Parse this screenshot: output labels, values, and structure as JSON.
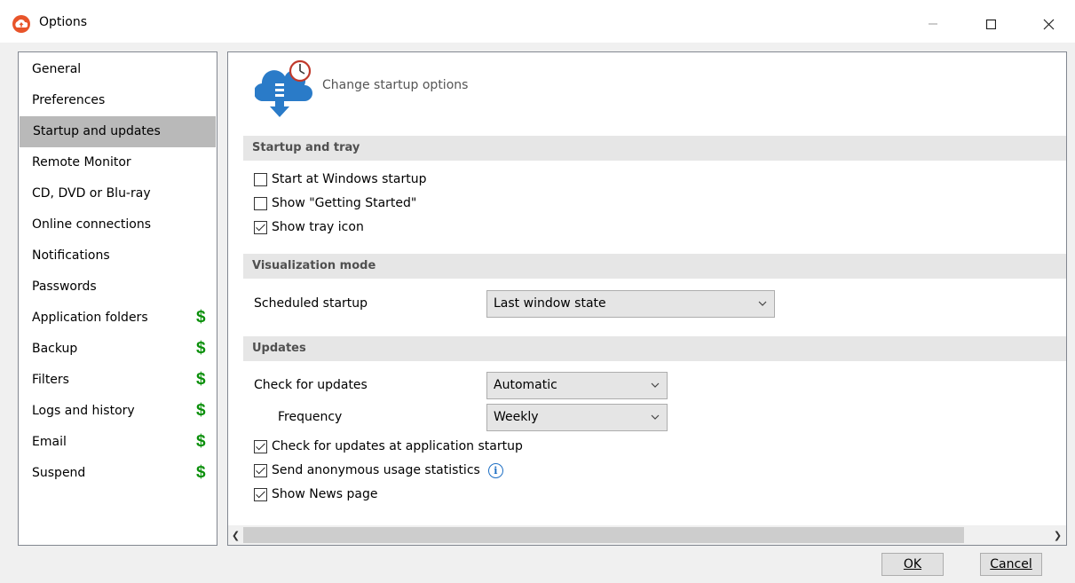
{
  "window": {
    "title": "Options"
  },
  "sidebar": {
    "items": [
      {
        "label": "General",
        "premium": false,
        "selected": false
      },
      {
        "label": "Preferences",
        "premium": false,
        "selected": false
      },
      {
        "label": "Startup and updates",
        "premium": false,
        "selected": true
      },
      {
        "label": "Remote Monitor",
        "premium": false,
        "selected": false
      },
      {
        "label": "CD, DVD or Blu-ray",
        "premium": false,
        "selected": false
      },
      {
        "label": "Online connections",
        "premium": false,
        "selected": false
      },
      {
        "label": "Notifications",
        "premium": false,
        "selected": false
      },
      {
        "label": "Passwords",
        "premium": false,
        "selected": false
      },
      {
        "label": "Application folders",
        "premium": true,
        "selected": false
      },
      {
        "label": "Backup",
        "premium": true,
        "selected": false
      },
      {
        "label": "Filters",
        "premium": true,
        "selected": false
      },
      {
        "label": "Logs and history",
        "premium": true,
        "selected": false
      },
      {
        "label": "Email",
        "premium": true,
        "selected": false
      },
      {
        "label": "Suspend",
        "premium": true,
        "selected": false
      }
    ],
    "premium_symbol": "$"
  },
  "main": {
    "header": "Change startup options",
    "sections": {
      "startup": "Startup and tray",
      "visualization": "Visualization mode",
      "updates": "Updates"
    },
    "startup_checks": [
      {
        "label": "Start at Windows startup",
        "checked": false
      },
      {
        "label": "Show \"Getting Started\"",
        "checked": false
      },
      {
        "label": "Show tray icon",
        "checked": true
      }
    ],
    "scheduled_startup": {
      "label": "Scheduled startup",
      "value": "Last window state"
    },
    "check_for_updates": {
      "label": "Check for updates",
      "value": "Automatic"
    },
    "frequency": {
      "label": "Frequency",
      "value": "Weekly"
    },
    "update_checks": [
      {
        "label": "Check for updates at application startup",
        "checked": true
      },
      {
        "label": "Send anonymous usage statistics",
        "checked": true
      },
      {
        "label": "Show News page",
        "checked": true
      }
    ]
  },
  "buttons": {
    "ok": "OK",
    "cancel": "Cancel"
  },
  "colors": {
    "accent_orange": "#e8542a",
    "premium_green": "#0a8f0a",
    "selected_bg": "#b9b9b9",
    "info_blue": "#1e6fc4"
  }
}
